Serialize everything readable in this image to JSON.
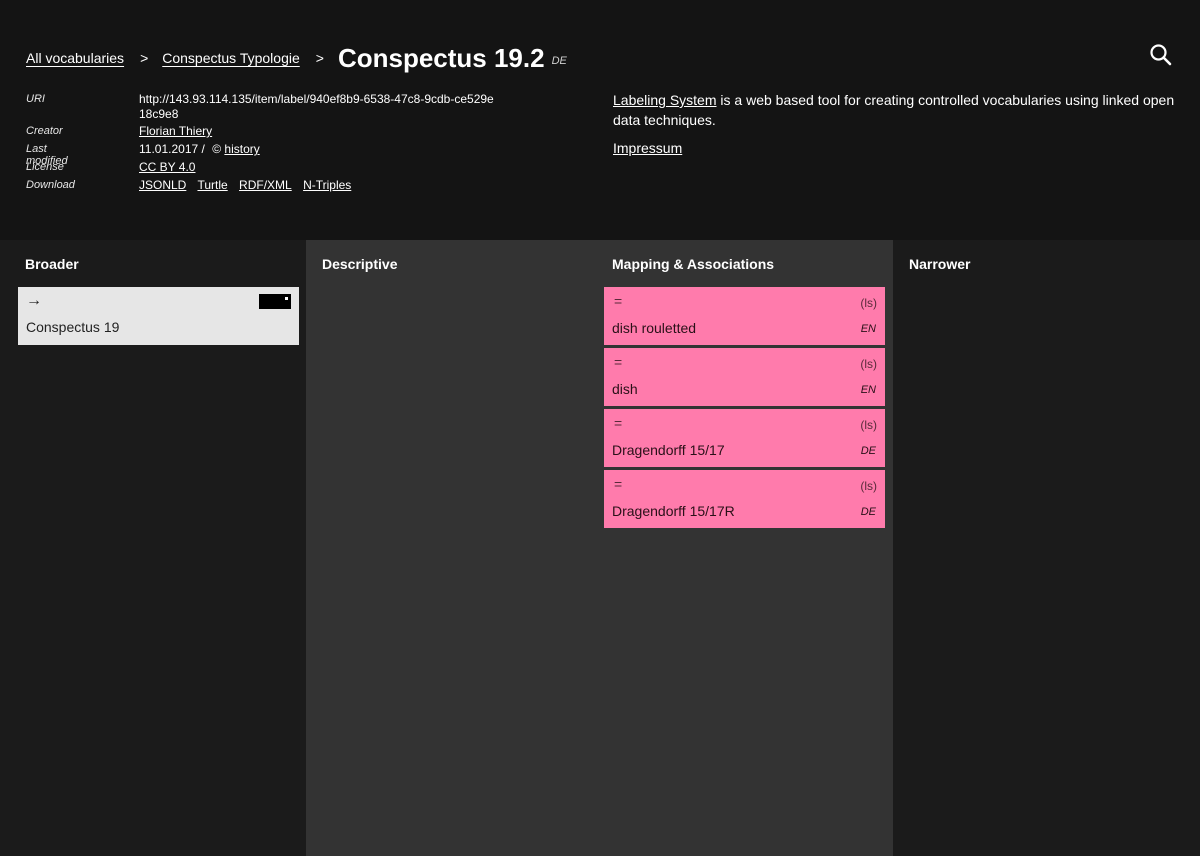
{
  "breadcrumb": {
    "items": [
      "All vocabularies",
      "Conspectus Typologie"
    ],
    "separator": ">"
  },
  "title": {
    "text": "Conspectus 19.2",
    "lang": "DE"
  },
  "meta": {
    "uri_label": "URI",
    "uri_value": "http://143.93.114.135/item/label/940ef8b9-6538-47c8-9cdb-ce529e18c9e8",
    "creator_label": "Creator",
    "creator_value": "Florian Thiery",
    "modified_label": "Last modified",
    "modified_date": "11.01.2017",
    "modified_sep": "/",
    "history_symbol": "©",
    "history_link": "history",
    "license_label": "License",
    "license_value": "CC BY 4.0",
    "download_label": "Download",
    "downloads": [
      "JSONLD",
      "Turtle",
      "RDF/XML",
      "N-Triples"
    ]
  },
  "about": {
    "link": "Labeling System",
    "text": " is a web based tool for creating controlled vocabularies using linked open data techniques.",
    "impressum": "Impressum"
  },
  "columns": {
    "broader": "Broader",
    "descriptive": "Descriptive",
    "mapping": "Mapping & Associations",
    "narrower": "Narrower"
  },
  "broader_items": [
    {
      "arrow": "→",
      "label": "Conspectus 19"
    }
  ],
  "mapping_items": [
    {
      "relation": "=",
      "source": "(ls)",
      "label": "dish rouletted",
      "lang": "EN"
    },
    {
      "relation": "=",
      "source": "(ls)",
      "label": "dish",
      "lang": "EN"
    },
    {
      "relation": "=",
      "source": "(ls)",
      "label": "Dragendorff 15/17",
      "lang": "DE"
    },
    {
      "relation": "=",
      "source": "(ls)",
      "label": "Dragendorff 15/17R",
      "lang": "DE"
    }
  ],
  "colors": {
    "header_bg": "#141414",
    "column_dark": "#1b1b1b",
    "column_mid": "#333333",
    "mapping_card": "#ff7bac",
    "broader_card": "#e6e6e6"
  },
  "icons": [
    "search-icon",
    "arrow-right-icon"
  ]
}
